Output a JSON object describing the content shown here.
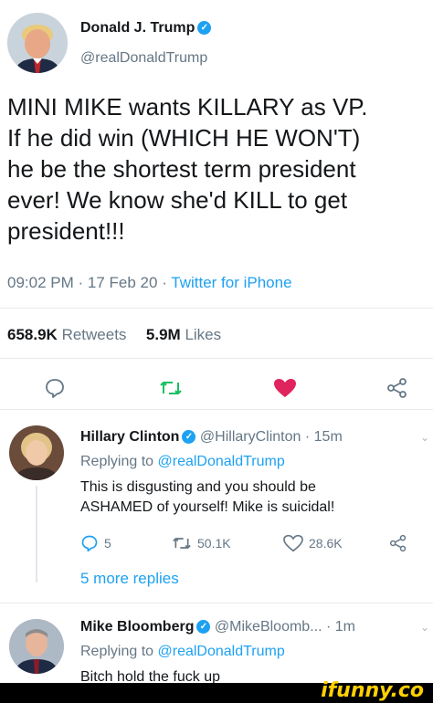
{
  "main_tweet": {
    "display_name": "Donald J. Trump",
    "handle": "@realDonaldTrump",
    "text_lines": [
      "MINI MIKE wants KILLARY as VP.",
      "If he did win (WHICH HE WON'T)",
      "he be the shortest term president",
      "ever! We know she'd KILL to get",
      "president!!!"
    ],
    "time": "09:02 PM",
    "date": "17 Feb 20",
    "source": "Twitter for iPhone",
    "retweets_count": "658.9K",
    "retweets_label": "Retweets",
    "likes_count": "5.9M",
    "likes_label": "Likes"
  },
  "replies": [
    {
      "display_name": "Hillary Clinton",
      "handle": "@HillaryClinton",
      "age": "15m",
      "replying_label": "Replying to",
      "replying_to": "@realDonaldTrump",
      "text_lines": [
        "This is disgusting and you should be",
        "ASHAMED of yourself! Mike is suicidal!"
      ],
      "reply_count": "5",
      "retweet_count": "50.1K",
      "like_count": "28.6K",
      "more_replies": "5 more replies"
    },
    {
      "display_name": "Mike Bloomberg",
      "handle": "@MikeBloomb...",
      "age": "1m",
      "replying_label": "Replying to",
      "replying_to": "@realDonaldTrump",
      "text_lines": [
        "Bitch hold the fuck up"
      ]
    }
  ],
  "watermark": "ifunny.co",
  "colors": {
    "accent": "#1da1f2",
    "like": "#e0245e",
    "retweet": "#17bf63",
    "muted": "#657786"
  },
  "icons": [
    "reply-icon",
    "retweet-icon",
    "heart-icon",
    "share-icon",
    "verified-icon",
    "chevron-down-icon"
  ]
}
